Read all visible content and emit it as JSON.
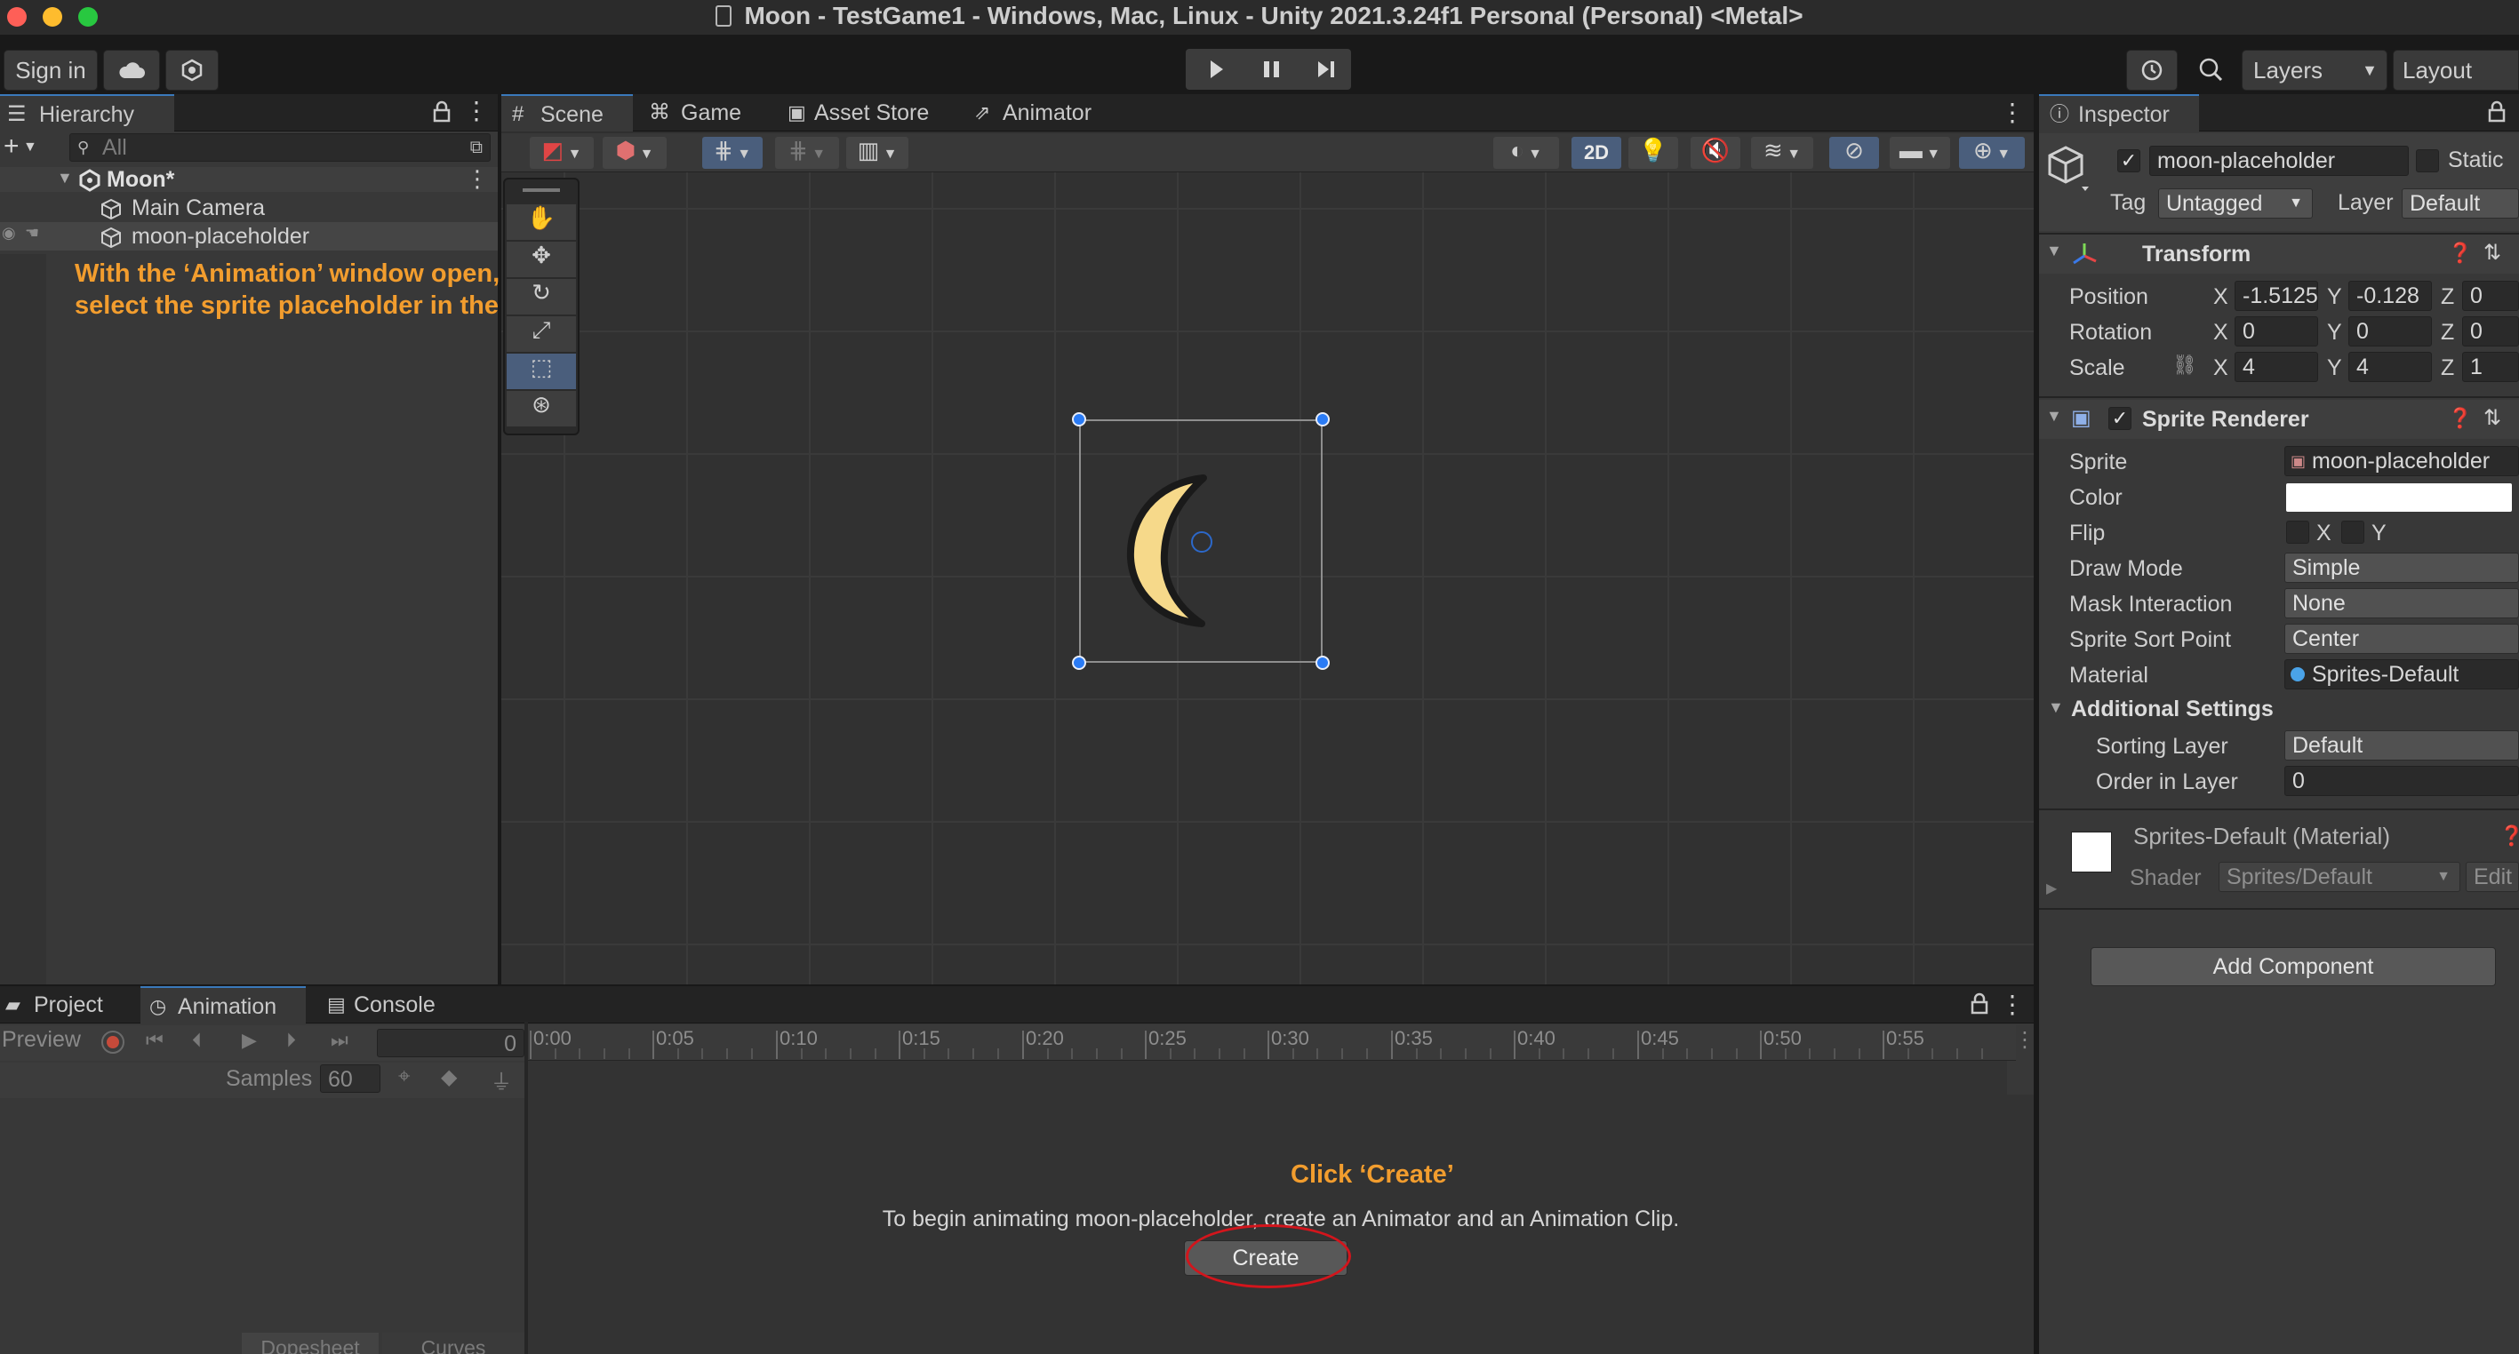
{
  "window": {
    "title": "Moon - TestGame1 - Windows, Mac, Linux - Unity 2021.3.24f1 Personal (Personal) <Metal>"
  },
  "toolbar": {
    "sign_in": "Sign in",
    "layers": "Layers",
    "layout": "Layout"
  },
  "hierarchy": {
    "tab": "Hierarchy",
    "search_placeholder": "All",
    "scene_name": "Moon*",
    "items": [
      "Main Camera",
      "moon-placeholder"
    ]
  },
  "scene_view": {
    "tabs": [
      "Scene",
      "Game",
      "Asset Store",
      "Animator"
    ],
    "mode_2d": "2D"
  },
  "annotations": {
    "hierarchy_note_line1": "With the ‘Animation’ window open,",
    "hierarchy_note_line2": "select the sprite placeholder in the hierarchy",
    "click_create": "Click ‘Create’"
  },
  "inspector": {
    "tab": "Inspector",
    "object_name": "moon-placeholder",
    "static_label": "Static",
    "tag_label": "Tag",
    "tag_value": "Untagged",
    "layer_label": "Layer",
    "layer_value": "Default",
    "transform": {
      "title": "Transform",
      "position_label": "Position",
      "rotation_label": "Rotation",
      "scale_label": "Scale",
      "axis_x": "X",
      "axis_y": "Y",
      "axis_z": "Z",
      "position": [
        "-1.5125",
        "-0.128",
        "0"
      ],
      "rotation": [
        "0",
        "0",
        "0"
      ],
      "scale": [
        "4",
        "4",
        "1"
      ]
    },
    "sprite_renderer": {
      "title": "Sprite Renderer",
      "sprite_label": "Sprite",
      "sprite_value": "moon-placeholder",
      "color_label": "Color",
      "color_value": "#ffffff",
      "flip_label": "Flip",
      "flip_x": "X",
      "flip_y": "Y",
      "draw_mode_label": "Draw Mode",
      "draw_mode_value": "Simple",
      "mask_label": "Mask Interaction",
      "mask_value": "None",
      "sort_point_label": "Sprite Sort Point",
      "sort_point_value": "Center",
      "material_label": "Material",
      "material_value": "Sprites-Default",
      "additional_settings": "Additional Settings",
      "sorting_layer_label": "Sorting Layer",
      "sorting_layer_value": "Default",
      "order_label": "Order in Layer",
      "order_value": "0"
    },
    "material": {
      "name": "Sprites-Default (Material)",
      "shader_label": "Shader",
      "shader_value": "Sprites/Default",
      "edit": "Edit"
    },
    "add_component": "Add Component"
  },
  "bottom_panel": {
    "tabs": [
      "Project",
      "Animation",
      "Console"
    ],
    "preview": "Preview",
    "frame": "0",
    "samples_label": "Samples",
    "samples_value": "60",
    "timeline_ticks": [
      "0:00",
      "0:05",
      "0:10",
      "0:15",
      "0:20",
      "0:25",
      "0:30",
      "0:35",
      "0:40",
      "0:45",
      "0:50",
      "0:55"
    ],
    "message": "To begin animating moon-placeholder, create an Animator and an Animation Clip.",
    "create_button": "Create",
    "dopesheet": "Dopesheet",
    "curves": "Curves"
  },
  "colors": {
    "accent": "#3a79bb",
    "annotation": "#f29d2e",
    "highlight_circle": "#d3151c",
    "moon": "#f6d98a"
  }
}
